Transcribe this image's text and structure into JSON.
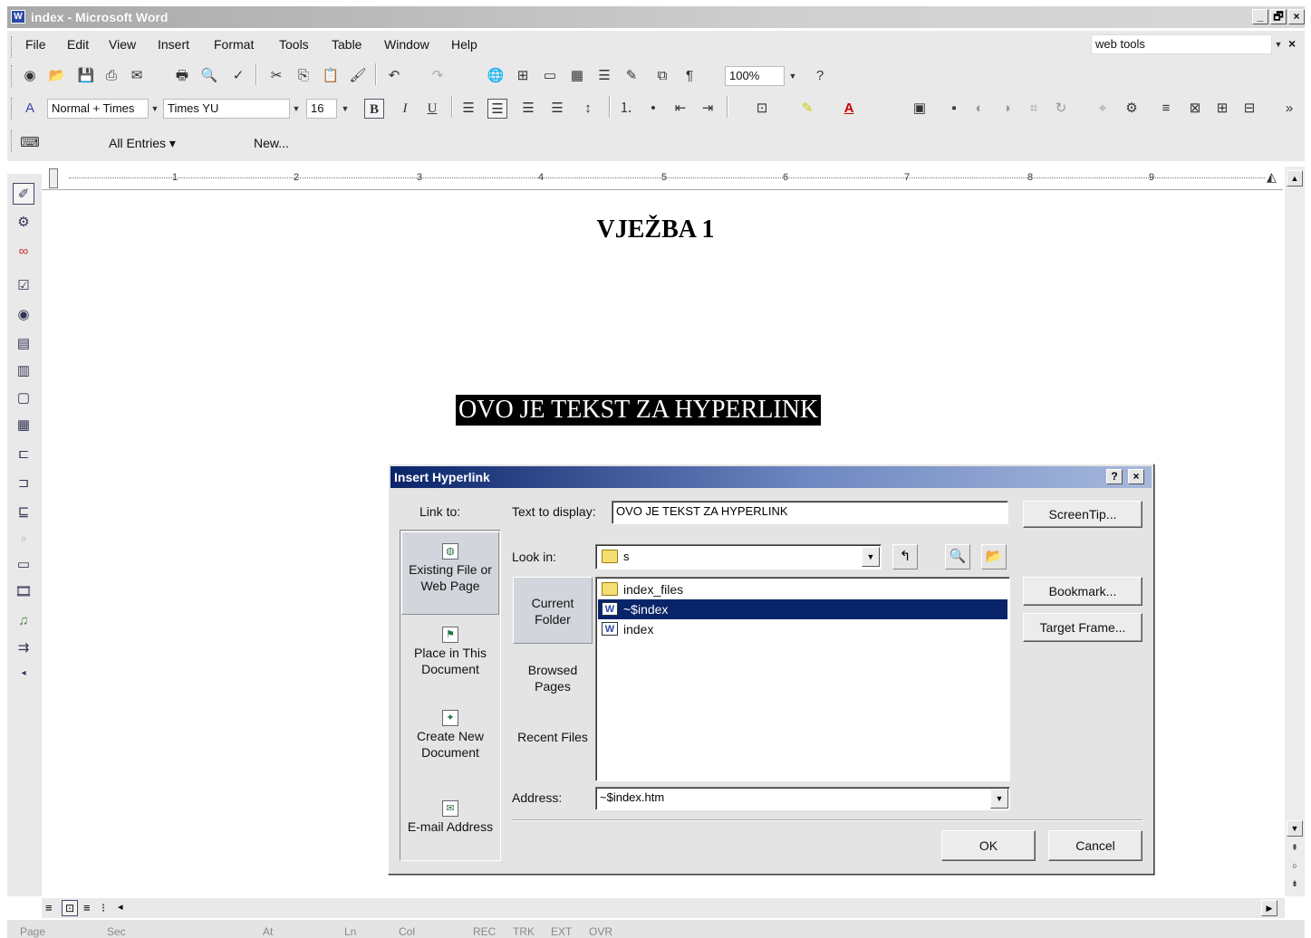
{
  "window": {
    "title": "index - Microsoft Word",
    "min_label": "_",
    "max_label": "🗗",
    "close_label": "×"
  },
  "menubar": {
    "items": [
      "File",
      "Edit",
      "View",
      "Insert",
      "Format",
      "Tools",
      "Table",
      "Window",
      "Help"
    ],
    "help_box": "web tools",
    "close_label": "×"
  },
  "formatting": {
    "style": "Normal + Times",
    "font": "Times YU",
    "size": "16",
    "zoom": "100%",
    "bold": "B",
    "italic": "I",
    "underline": "U"
  },
  "autotext": {
    "all_entries": "All Entries ▾",
    "new": "New..."
  },
  "ruler": {
    "ticks": [
      "1",
      "2",
      "3",
      "4",
      "5",
      "6",
      "7",
      "8",
      "9"
    ]
  },
  "document": {
    "heading": "VJEŽBA 1",
    "selected_text": "OVO JE TEKST ZA HYPERLINK"
  },
  "dialog": {
    "title": "Insert Hyperlink",
    "help_label": "?",
    "close_label": "×",
    "link_to_label": "Link to:",
    "text_to_display_label": "Text to display:",
    "text_to_display_value": "OVO JE TEKST ZA HYPERLINK",
    "screentip_button": "ScreenTip...",
    "look_in_label": "Look in:",
    "look_in_value": "s",
    "link_targets": [
      {
        "label": "Existing File or Web Page",
        "icon": "globe-page-icon"
      },
      {
        "label": "Place in This Document",
        "icon": "bookmark-doc-icon"
      },
      {
        "label": "Create New Document",
        "icon": "new-doc-icon"
      },
      {
        "label": "E-mail Address",
        "icon": "email-icon"
      }
    ],
    "nav": [
      {
        "label": "Current Folder"
      },
      {
        "label": "Browsed Pages"
      },
      {
        "label": "Recent Files"
      }
    ],
    "files": [
      {
        "name": "index_files",
        "icon": "folder-icon",
        "selected": false
      },
      {
        "name": "~$index",
        "icon": "word-doc-icon",
        "selected": true
      },
      {
        "name": "index",
        "icon": "word-doc-icon",
        "selected": false
      }
    ],
    "bookmark_button": "Bookmark...",
    "target_frame_button": "Target Frame...",
    "address_label": "Address:",
    "address_value": "~$index.htm",
    "ok_button": "OK",
    "cancel_button": "Cancel"
  },
  "statusbar": {
    "items": [
      "Page",
      "Sec",
      "At",
      "Ln",
      "Col",
      "REC",
      "TRK",
      "EXT",
      "OVR"
    ]
  }
}
